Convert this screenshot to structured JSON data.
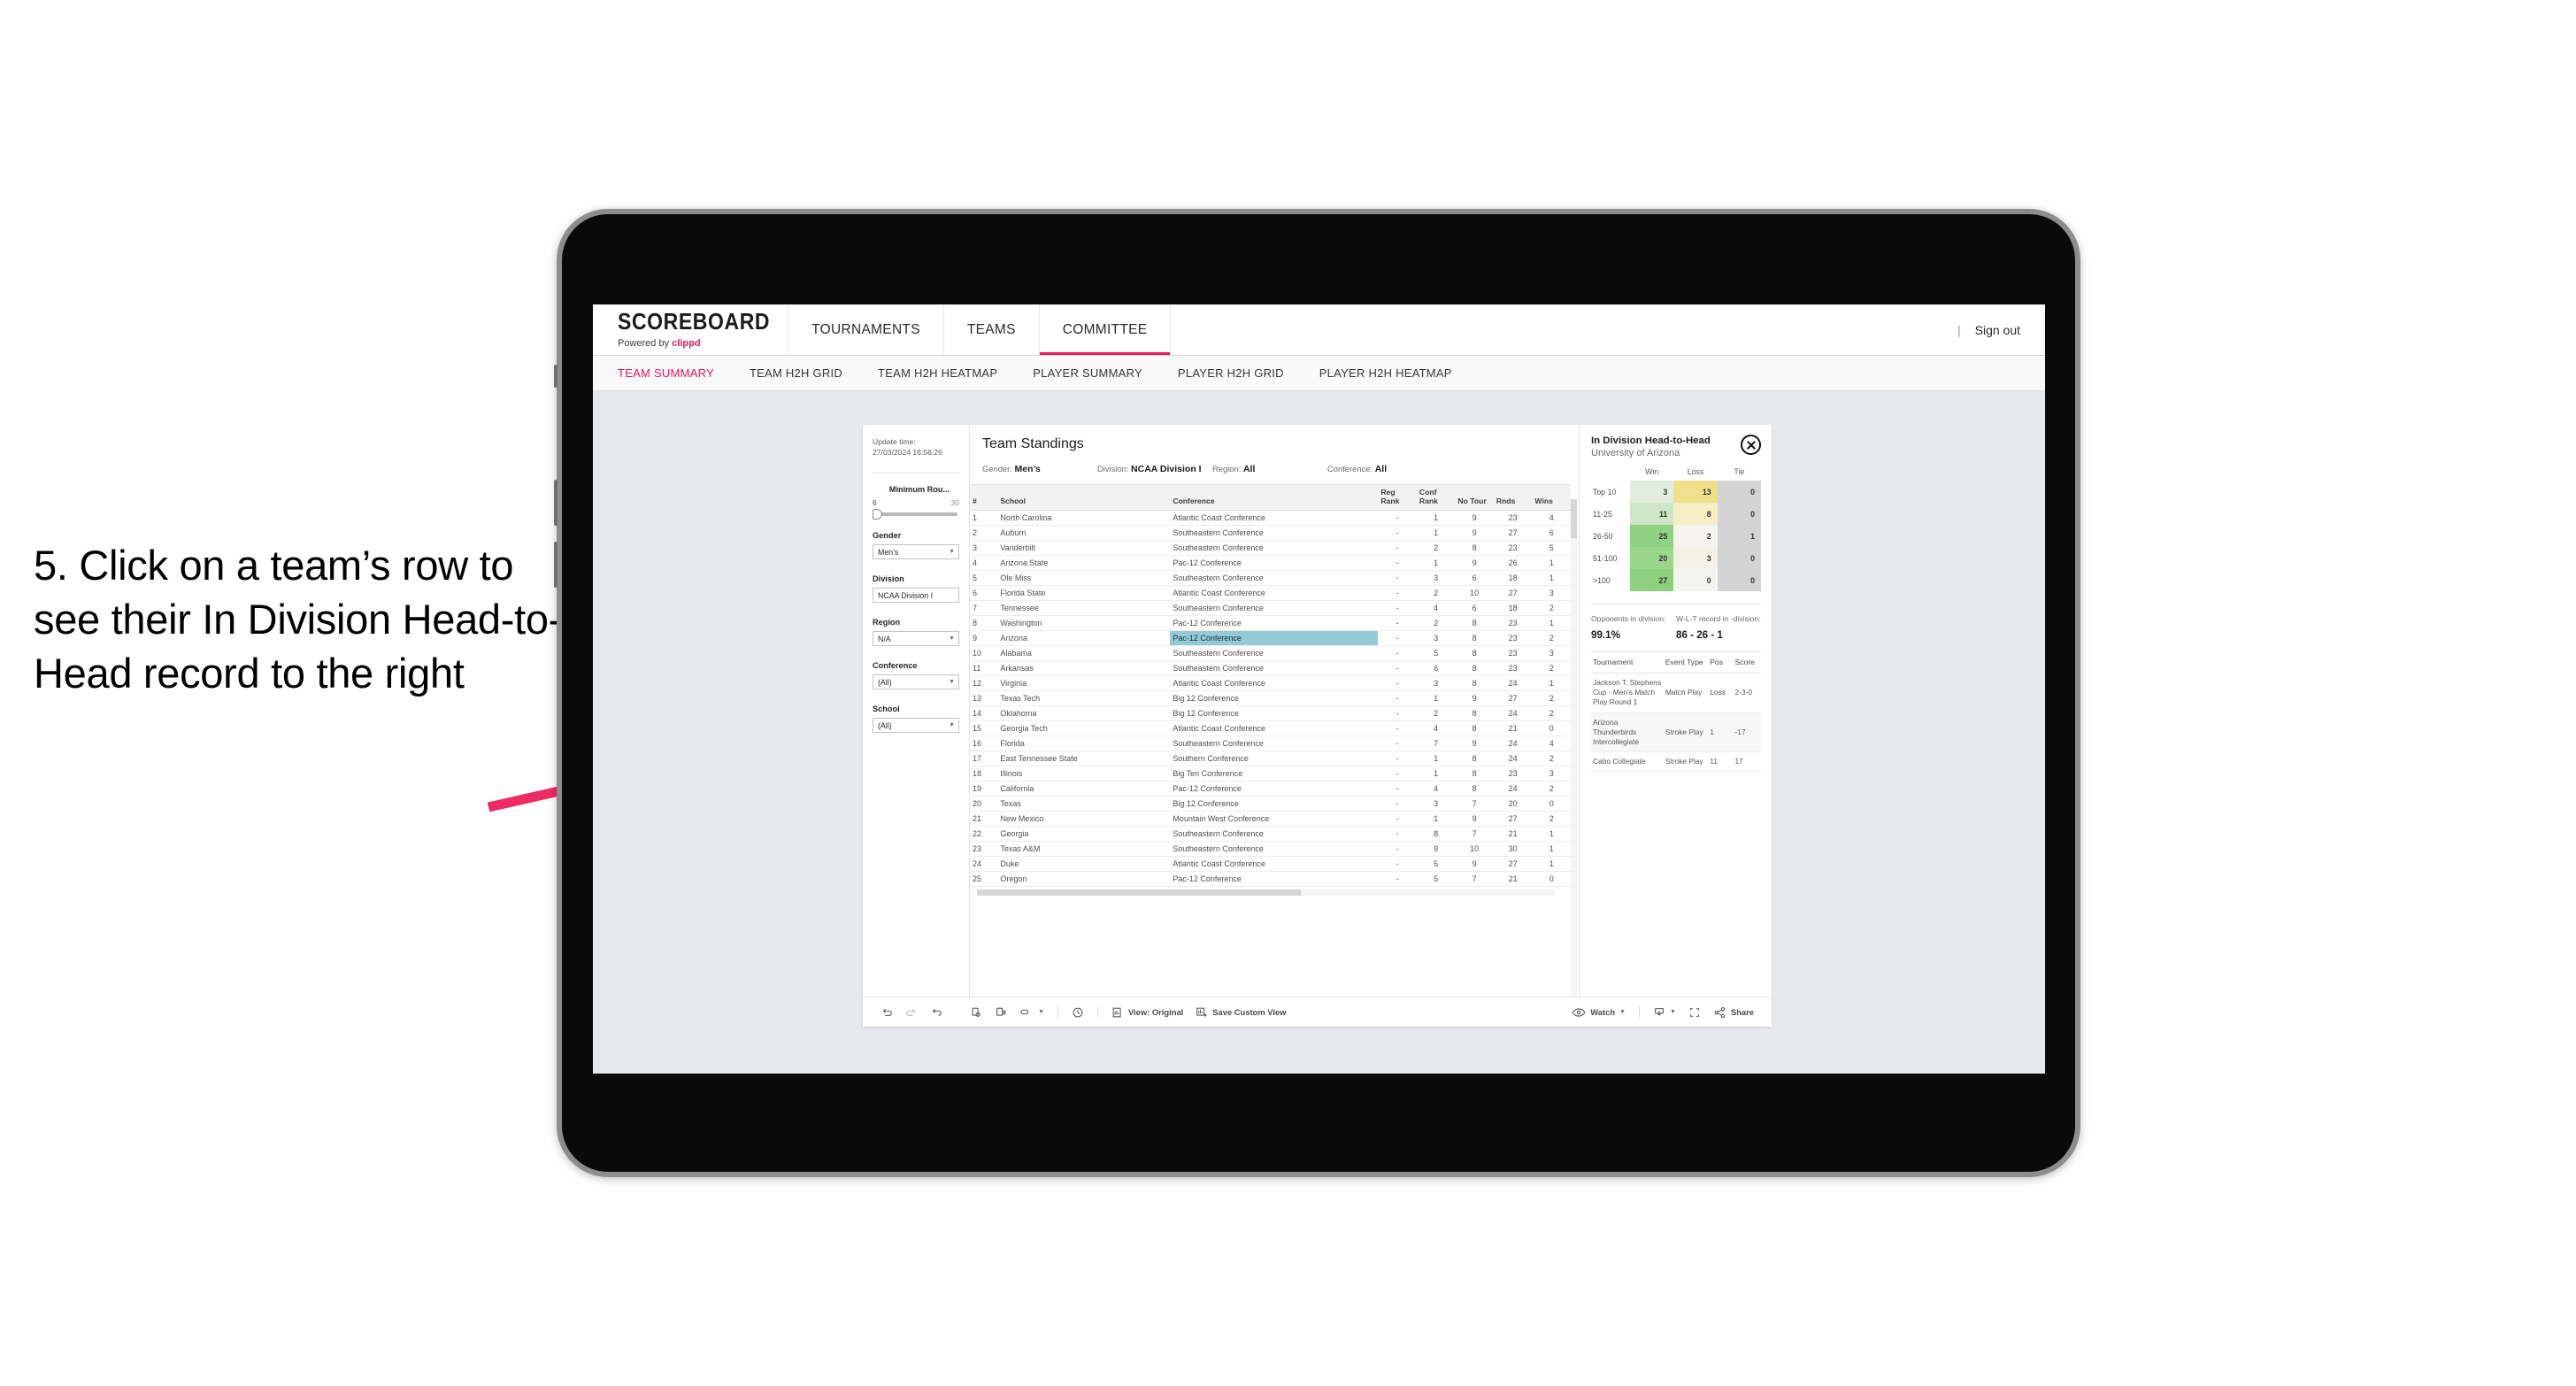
{
  "annotation": {
    "text": "5. Click on a team’s row to see their In Division Head-to-Head record to the right",
    "arrow_color": "#ed2a63"
  },
  "topnav": {
    "brand": "SCOREBOARD",
    "brand_sub_prefix": "Powered by ",
    "brand_sub_brand": "clippd",
    "items": [
      {
        "label": "TOURNAMENTS",
        "active": false
      },
      {
        "label": "TEAMS",
        "active": false
      },
      {
        "label": "COMMITTEE",
        "active": true
      }
    ],
    "divider": "|",
    "signout": "Sign out",
    "accent": "#e8175d"
  },
  "subnav": {
    "tabs": [
      {
        "label": "TEAM SUMMARY",
        "active": true
      },
      {
        "label": "TEAM H2H GRID",
        "active": false
      },
      {
        "label": "TEAM H2H HEATMAP",
        "active": false
      },
      {
        "label": "PLAYER SUMMARY",
        "active": false
      },
      {
        "label": "PLAYER H2H GRID",
        "active": false
      },
      {
        "label": "PLAYER H2H HEATMAP",
        "active": false
      }
    ]
  },
  "rail": {
    "update_label": "Update time:",
    "update_value": "27/03/2024 16:56:26",
    "slider": {
      "title": "Minimum Rou...",
      "min": "6",
      "max": "30"
    },
    "filters": [
      {
        "title": "Gender",
        "value": "Men’s"
      },
      {
        "title": "Division",
        "value": "NCAA Division I"
      },
      {
        "title": "Region",
        "value": "N/A"
      },
      {
        "title": "Conference",
        "value": "(All)"
      },
      {
        "title": "School",
        "value": "(All)"
      }
    ]
  },
  "standings": {
    "title": "Team Standings",
    "summary": [
      {
        "label": "Gender:",
        "value": "Men’s"
      },
      {
        "label": "Division:",
        "value": "NCAA Division I"
      },
      {
        "label": "Region:",
        "value": "All"
      },
      {
        "label": "Conference:",
        "value": "All"
      }
    ],
    "columns": [
      "#",
      "School",
      "Conference",
      "Reg Rank",
      "Conf Rank",
      "No Tour",
      "Rnds",
      "Wins"
    ],
    "selected_row_index": 8,
    "rows": [
      {
        "num": "1",
        "school": "North Carolina",
        "conference": "Atlantic Coast Conference",
        "reg_rank": "-",
        "conf_rank": "1",
        "no_tour": "9",
        "rnds": "23",
        "wins": "4"
      },
      {
        "num": "2",
        "school": "Auburn",
        "conference": "Southeastern Conference",
        "reg_rank": "-",
        "conf_rank": "1",
        "no_tour": "9",
        "rnds": "27",
        "wins": "6"
      },
      {
        "num": "3",
        "school": "Vanderbilt",
        "conference": "Southeastern Conference",
        "reg_rank": "-",
        "conf_rank": "2",
        "no_tour": "8",
        "rnds": "23",
        "wins": "5"
      },
      {
        "num": "4",
        "school": "Arizona State",
        "conference": "Pac-12 Conference",
        "reg_rank": "-",
        "conf_rank": "1",
        "no_tour": "9",
        "rnds": "26",
        "wins": "1"
      },
      {
        "num": "5",
        "school": "Ole Miss",
        "conference": "Southeastern Conference",
        "reg_rank": "-",
        "conf_rank": "3",
        "no_tour": "6",
        "rnds": "18",
        "wins": "1"
      },
      {
        "num": "6",
        "school": "Florida State",
        "conference": "Atlantic Coast Conference",
        "reg_rank": "-",
        "conf_rank": "2",
        "no_tour": "10",
        "rnds": "27",
        "wins": "3"
      },
      {
        "num": "7",
        "school": "Tennessee",
        "conference": "Southeastern Conference",
        "reg_rank": "-",
        "conf_rank": "4",
        "no_tour": "6",
        "rnds": "18",
        "wins": "2"
      },
      {
        "num": "8",
        "school": "Washington",
        "conference": "Pac-12 Conference",
        "reg_rank": "-",
        "conf_rank": "2",
        "no_tour": "8",
        "rnds": "23",
        "wins": "1"
      },
      {
        "num": "9",
        "school": "Arizona",
        "conference": "Pac-12 Conference",
        "reg_rank": "-",
        "conf_rank": "3",
        "no_tour": "8",
        "rnds": "23",
        "wins": "2"
      },
      {
        "num": "10",
        "school": "Alabama",
        "conference": "Southeastern Conference",
        "reg_rank": "-",
        "conf_rank": "5",
        "no_tour": "8",
        "rnds": "23",
        "wins": "3"
      },
      {
        "num": "11",
        "school": "Arkansas",
        "conference": "Southeastern Conference",
        "reg_rank": "-",
        "conf_rank": "6",
        "no_tour": "8",
        "rnds": "23",
        "wins": "2"
      },
      {
        "num": "12",
        "school": "Virginia",
        "conference": "Atlantic Coast Conference",
        "reg_rank": "-",
        "conf_rank": "3",
        "no_tour": "8",
        "rnds": "24",
        "wins": "1"
      },
      {
        "num": "13",
        "school": "Texas Tech",
        "conference": "Big 12 Conference",
        "reg_rank": "-",
        "conf_rank": "1",
        "no_tour": "9",
        "rnds": "27",
        "wins": "2"
      },
      {
        "num": "14",
        "school": "Oklahoma",
        "conference": "Big 12 Conference",
        "reg_rank": "-",
        "conf_rank": "2",
        "no_tour": "8",
        "rnds": "24",
        "wins": "2"
      },
      {
        "num": "15",
        "school": "Georgia Tech",
        "conference": "Atlantic Coast Conference",
        "reg_rank": "-",
        "conf_rank": "4",
        "no_tour": "8",
        "rnds": "21",
        "wins": "0"
      },
      {
        "num": "16",
        "school": "Florida",
        "conference": "Southeastern Conference",
        "reg_rank": "-",
        "conf_rank": "7",
        "no_tour": "9",
        "rnds": "24",
        "wins": "4"
      },
      {
        "num": "17",
        "school": "East Tennessee State",
        "conference": "Southern Conference",
        "reg_rank": "-",
        "conf_rank": "1",
        "no_tour": "8",
        "rnds": "24",
        "wins": "2"
      },
      {
        "num": "18",
        "school": "Illinois",
        "conference": "Big Ten Conference",
        "reg_rank": "-",
        "conf_rank": "1",
        "no_tour": "8",
        "rnds": "23",
        "wins": "3"
      },
      {
        "num": "19",
        "school": "California",
        "conference": "Pac-12 Conference",
        "reg_rank": "-",
        "conf_rank": "4",
        "no_tour": "8",
        "rnds": "24",
        "wins": "2"
      },
      {
        "num": "20",
        "school": "Texas",
        "conference": "Big 12 Conference",
        "reg_rank": "-",
        "conf_rank": "3",
        "no_tour": "7",
        "rnds": "20",
        "wins": "0"
      },
      {
        "num": "21",
        "school": "New Mexico",
        "conference": "Mountain West Conference",
        "reg_rank": "-",
        "conf_rank": "1",
        "no_tour": "9",
        "rnds": "27",
        "wins": "2"
      },
      {
        "num": "22",
        "school": "Georgia",
        "conference": "Southeastern Conference",
        "reg_rank": "-",
        "conf_rank": "8",
        "no_tour": "7",
        "rnds": "21",
        "wins": "1"
      },
      {
        "num": "23",
        "school": "Texas A&M",
        "conference": "Southeastern Conference",
        "reg_rank": "-",
        "conf_rank": "9",
        "no_tour": "10",
        "rnds": "30",
        "wins": "1"
      },
      {
        "num": "24",
        "school": "Duke",
        "conference": "Atlantic Coast Conference",
        "reg_rank": "-",
        "conf_rank": "5",
        "no_tour": "9",
        "rnds": "27",
        "wins": "1"
      },
      {
        "num": "25",
        "school": "Oregon",
        "conference": "Pac-12 Conference",
        "reg_rank": "-",
        "conf_rank": "5",
        "no_tour": "7",
        "rnds": "21",
        "wins": "0"
      }
    ]
  },
  "h2h": {
    "title": "In Division Head-to-Head",
    "subtitle": "University of Arizona",
    "close_icon": "close-circle-icon",
    "columns": [
      "",
      "Win",
      "Loss",
      "Tie"
    ],
    "rows": [
      {
        "band": "Top 10",
        "win": "3",
        "loss": "13",
        "tie": "0",
        "win_bg": "#e2eedd",
        "loss_bg": "#f0e08a",
        "tie_bg": "#d4d4d4"
      },
      {
        "band": "11-25",
        "win": "11",
        "loss": "8",
        "tie": "0",
        "win_bg": "#cfe6c6",
        "loss_bg": "#f6eec4",
        "tie_bg": "#d4d4d4"
      },
      {
        "band": "26-50",
        "win": "25",
        "loss": "2",
        "tie": "1",
        "win_bg": "#91d184",
        "loss_bg": "#f4f3ec",
        "tie_bg": "#d4d4d4"
      },
      {
        "band": "51-100",
        "win": "20",
        "loss": "3",
        "tie": "0",
        "win_bg": "#9bd68d",
        "loss_bg": "#f4f1e6",
        "tie_bg": "#d4d4d4"
      },
      {
        "band": ">100",
        "win": "27",
        "loss": "0",
        "tie": "0",
        "win_bg": "#8ed07f",
        "loss_bg": "#f4f4f1",
        "tie_bg": "#d4d4d4"
      }
    ],
    "stats": [
      {
        "label": "Opponents in division:",
        "value": "99.1%"
      },
      {
        "label": "W-L-T record in -division:",
        "value": "86 - 26 - 1"
      }
    ],
    "events_columns": [
      "Tournament",
      "Event Type",
      "Pos",
      "Score"
    ],
    "events": [
      {
        "tournament": "Jackson T. Stephens Cup - Men’s Match Play Round 1",
        "event_type": "Match Play",
        "pos": "Loss",
        "score": "2-3-0"
      },
      {
        "tournament": "Arizona Thunderbirds Intercollegiate",
        "event_type": "Stroke Play",
        "pos": "1",
        "score": "-17"
      },
      {
        "tournament": "Cabo Collegiate",
        "event_type": "Stroke Play",
        "pos": "11",
        "score": "17"
      }
    ]
  },
  "toolbar": {
    "undo": "undo-icon",
    "redo": "redo-icon",
    "revert": "revert-icon",
    "refresh": "refresh-data-icon",
    "pause": "pause-auto-update-icon",
    "dropdown": "flag-dropdown-icon",
    "history": "history-icon",
    "view_label": "View: Original",
    "save_label": "Save Custom View",
    "watch_label": "Watch",
    "download_icon": "download-icon",
    "fullscreen_icon": "fullscreen-icon",
    "share_label": "Share"
  },
  "chart_data": {
    "type": "heatmap",
    "title": "In Division Head-to-Head",
    "subtitle": "University of Arizona",
    "xlabel": "",
    "ylabel": "",
    "columns": [
      "Win",
      "Loss",
      "Tie"
    ],
    "rows": [
      "Top 10",
      "11-25",
      "26-50",
      "51-100",
      ">100"
    ],
    "values": [
      [
        3,
        13,
        0
      ],
      [
        11,
        8,
        0
      ],
      [
        25,
        2,
        1
      ],
      [
        20,
        3,
        0
      ],
      [
        27,
        0,
        0
      ]
    ],
    "legend_position": "none",
    "grid": false
  }
}
